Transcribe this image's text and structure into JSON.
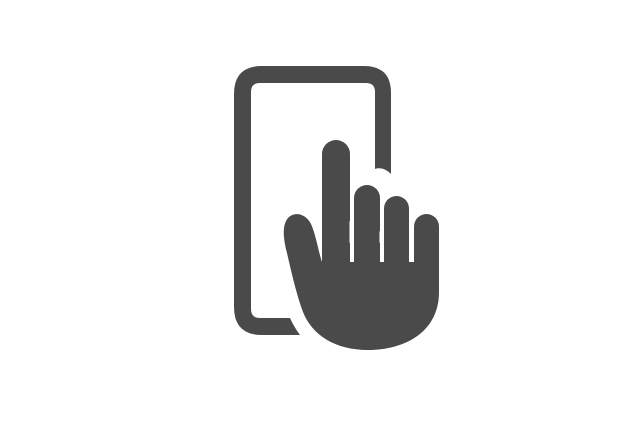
{
  "icon": {
    "name": "touch-screen-icon",
    "description_name": "hand-tapping-phone",
    "color": "#4a4a4a",
    "background": "#ffffff"
  }
}
